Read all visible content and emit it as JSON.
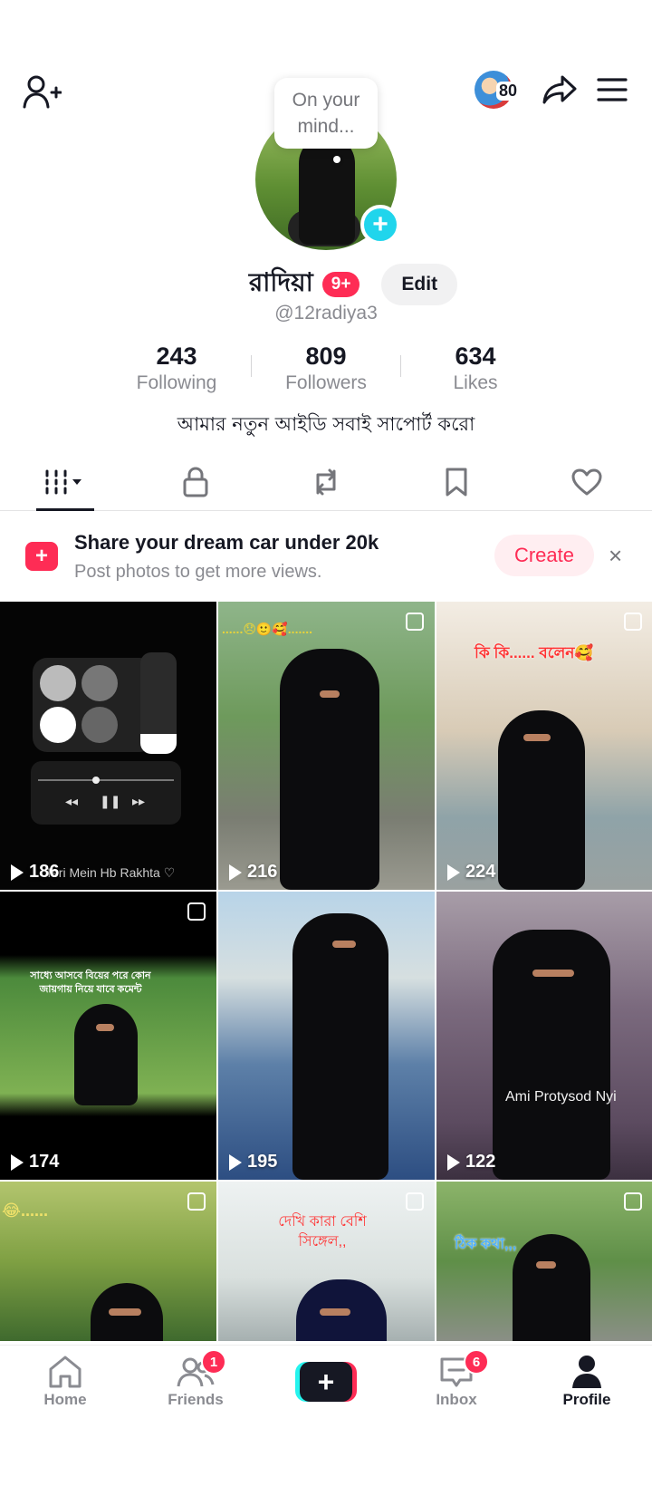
{
  "top_bar": {
    "story_count": "80"
  },
  "profile": {
    "bubble_text": "On your mind...",
    "name": "রাদিয়া",
    "notification_count": "9+",
    "edit_label": "Edit",
    "username": "@12radiya3",
    "bio": "আমার নতুন আইডি সবাই সাপোর্ট করো",
    "stats": [
      {
        "value": "243",
        "label": "Following"
      },
      {
        "value": "809",
        "label": "Followers"
      },
      {
        "value": "634",
        "label": "Likes"
      }
    ]
  },
  "tabs": [
    {
      "name": "videos",
      "icon": "grid-bars-icon",
      "active": true
    },
    {
      "name": "private",
      "icon": "lock-icon"
    },
    {
      "name": "reposts",
      "icon": "repost-icon"
    },
    {
      "name": "favorites",
      "icon": "bookmark-icon"
    },
    {
      "name": "liked",
      "icon": "heart-icon"
    }
  ],
  "promo": {
    "title": "Share your dream car under 20k",
    "subtitle": "Post photos to get more views.",
    "create_label": "Create",
    "close_label": "×"
  },
  "videos": [
    {
      "views": "186",
      "caption": "Teri Mein Hb Rakhta ♡"
    },
    {
      "views": "216",
      "caption": "......😞🙂🥰......."
    },
    {
      "views": "224",
      "caption": "কি কি...... বলেন🥰"
    },
    {
      "views": "174",
      "caption": "সাধ্যে আসবে বিয়ের পরে কোন জায়গায় নিয়ে যাবে কমেন্ট"
    },
    {
      "views": "195",
      "caption": ""
    },
    {
      "views": "122",
      "caption": "Ami Protysod Nyi"
    },
    {
      "views": "",
      "caption": "😂......"
    },
    {
      "views": "",
      "caption": "দেখি কারা বেশি সিঙ্গেল,,"
    },
    {
      "views": "",
      "caption": "ঠিক কথা,,,"
    }
  ],
  "bottom_nav": {
    "home": "Home",
    "friends": "Friends",
    "friends_badge": "1",
    "create": "+",
    "inbox": "Inbox",
    "inbox_badge": "6",
    "profile": "Profile"
  },
  "colors": {
    "accent": "#fe2c55",
    "cyan": "#25f4ee",
    "text": "#161823",
    "muted": "#8a8b91"
  }
}
